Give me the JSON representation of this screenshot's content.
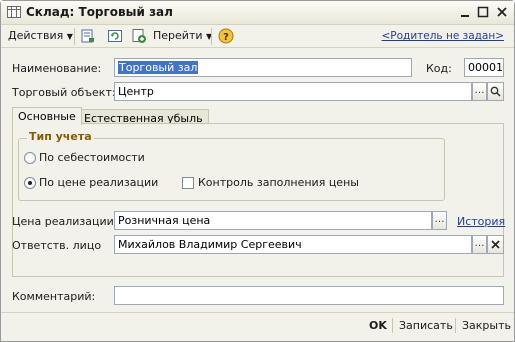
{
  "window": {
    "title": "Склад: Торговый зал"
  },
  "toolbar": {
    "actions_label": "Действия",
    "goto_label": "Перейти",
    "parent_link": "<Родитель не задан>"
  },
  "form": {
    "name_label": "Наименование:",
    "name_value": "Торговый зал",
    "code_label": "Код:",
    "code_value": "00001",
    "trade_object_label": "Торговый объект:",
    "trade_object_value": "Центр",
    "tabs": [
      {
        "label": "Основные"
      },
      {
        "label": "Естественная убыль"
      }
    ],
    "accounting_group_title": "Тип учета",
    "radio_cost": "По себестоимости",
    "radio_sale_price": "По цене реализации",
    "checkbox_price_control": "Контроль заполнения цены",
    "sale_price_label": "Цена реализации:",
    "sale_price_value": "Розничная цена",
    "history_link": "История",
    "responsible_label": "Ответств. лицо",
    "responsible_value": "Михайлов Владимир Сергеевич",
    "comment_label": "Комментарий:",
    "comment_value": ""
  },
  "footer": {
    "ok_label": "OK",
    "save_label": "Записать",
    "close_label": "Закрыть"
  },
  "state": {
    "selected_radio": "sale_price",
    "price_control_checked": false
  },
  "colors": {
    "accent_link": "#1f3da0",
    "selection": "#3f74c8",
    "group_title": "#8a5a00"
  }
}
